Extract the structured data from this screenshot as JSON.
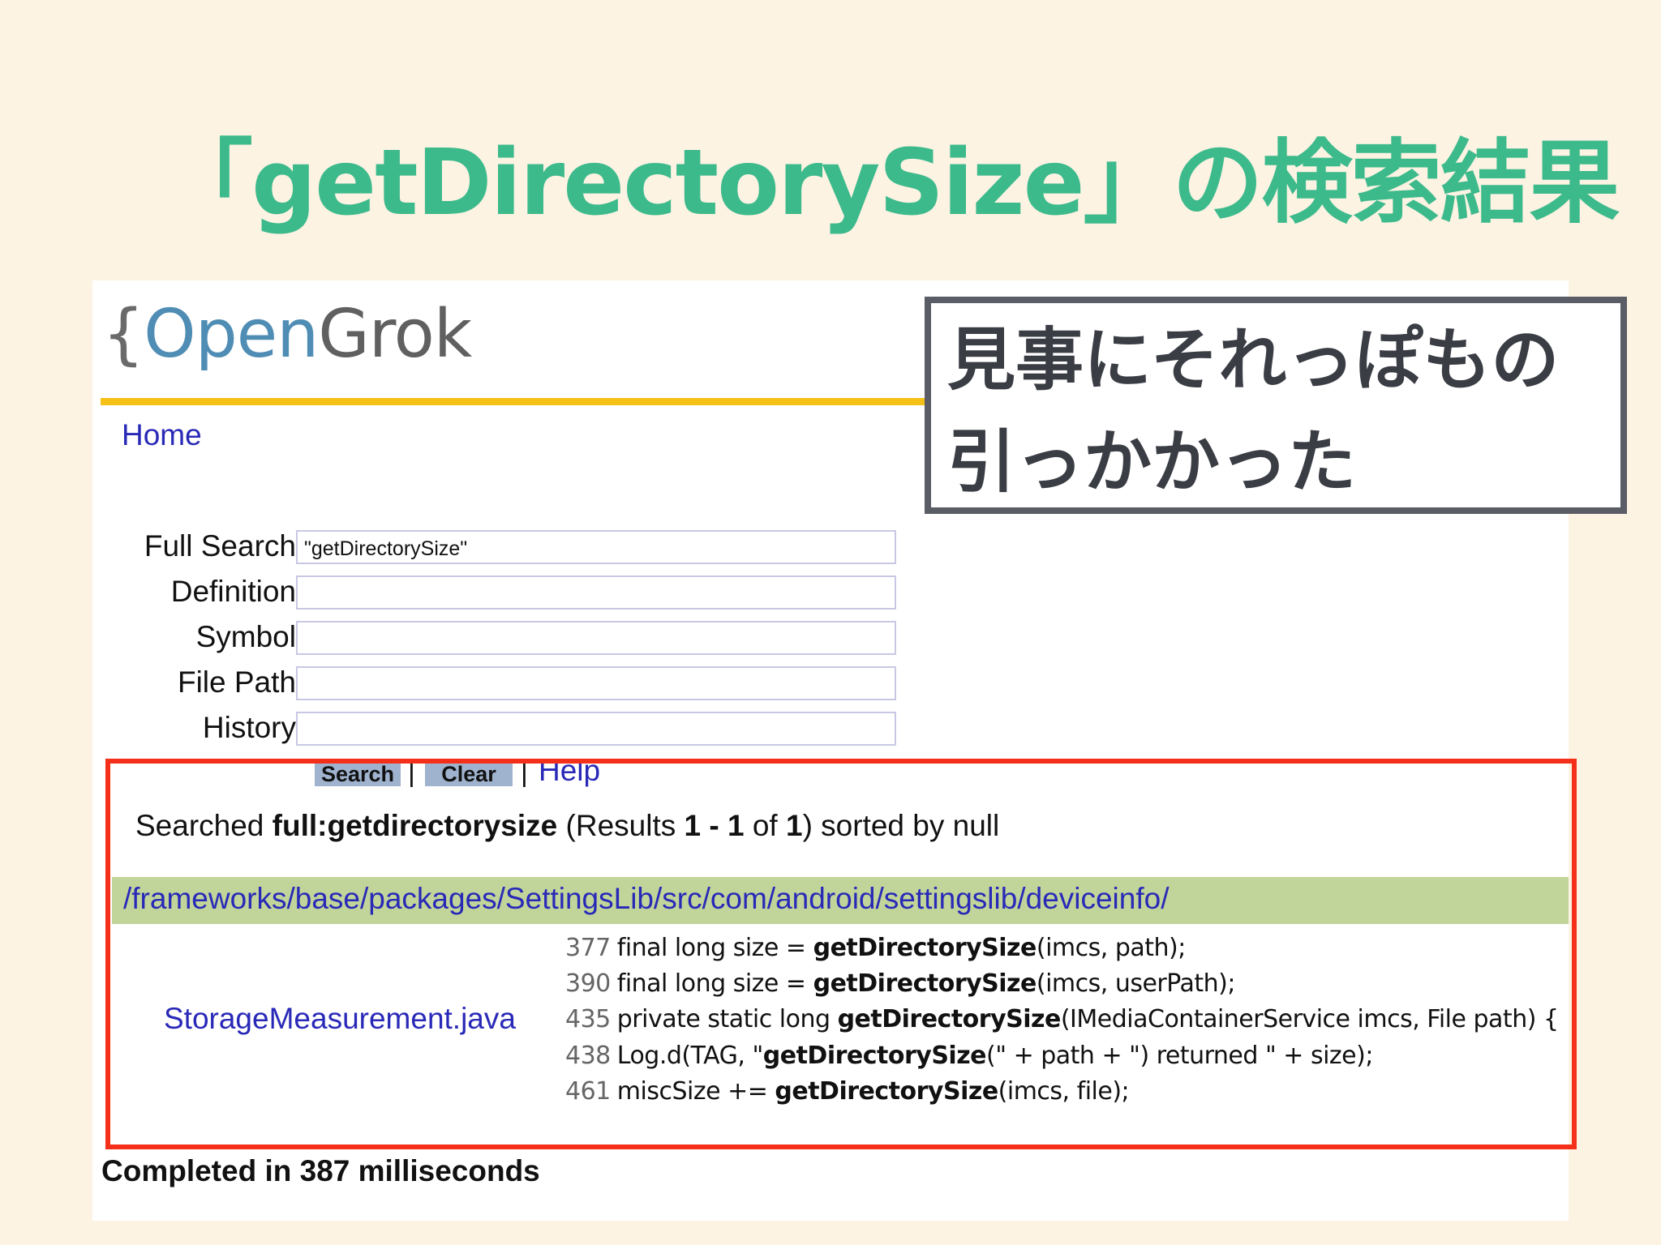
{
  "slide": {
    "title": "「getDirectorySize」の検索結果"
  },
  "logo": {
    "brace": "{",
    "open": "Open",
    "grok": "Grok"
  },
  "nav": {
    "home": "Home"
  },
  "form": {
    "fields": [
      {
        "label": "Full Search",
        "value": "\"getDirectorySize\""
      },
      {
        "label": "Definition",
        "value": ""
      },
      {
        "label": "Symbol",
        "value": ""
      },
      {
        "label": "File Path",
        "value": ""
      },
      {
        "label": "History",
        "value": ""
      }
    ],
    "search_button": "Search",
    "clear_button": "Clear",
    "help_link": "Help",
    "separator": "|"
  },
  "results": {
    "summary_prefix": "Searched ",
    "query": "full:getdirectorysize",
    "summary_mid1": " (Results ",
    "range": "1 - 1",
    "summary_mid2": " of ",
    "total": "1",
    "summary_suffix": ") sorted by null",
    "directory": "/frameworks/base/packages/SettingsLib/src/com/android/settingslib/deviceinfo/",
    "file": "StorageMeasurement.java",
    "lines": [
      {
        "num": "377",
        "pre": "final long size = ",
        "hl": "getDirectorySize",
        "post": "(imcs, path);"
      },
      {
        "num": "390",
        "pre": "final long size = ",
        "hl": "getDirectorySize",
        "post": "(imcs, userPath);"
      },
      {
        "num": "435",
        "pre": "private static long ",
        "hl": "getDirectorySize",
        "post": "(IMediaContainerService imcs, File path) {"
      },
      {
        "num": "438",
        "pre": "Log.d(TAG, \"",
        "hl": "getDirectorySize",
        "post": "(\" + path + \") returned \" + size);"
      },
      {
        "num": "461",
        "pre": "miscSize += ",
        "hl": "getDirectorySize",
        "post": "(imcs, file);"
      }
    ],
    "completed": "Completed in 387 milliseconds"
  },
  "annotation": {
    "line1": "見事にそれっぽもの",
    "line2": "引っかかった"
  },
  "colors": {
    "background": "#fdf3e3",
    "title": "#3dba8c",
    "highlight_box": "#f5301a",
    "rule": "#f5c117",
    "dir_bar": "#c1d59a",
    "link": "#2929b8"
  }
}
